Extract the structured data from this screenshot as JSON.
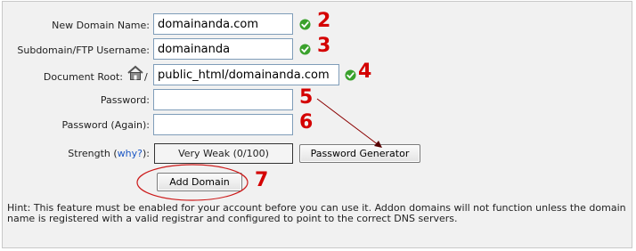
{
  "form": {
    "new_domain": {
      "label": "New Domain Name:",
      "value": "domainanda.com",
      "marker": "2"
    },
    "subdomain": {
      "label": "Subdomain/FTP Username:",
      "value": "domainanda",
      "marker": "3"
    },
    "docroot": {
      "label": "Document Root:",
      "prefix": "/",
      "value": "public_html/domainanda.com",
      "marker": "4",
      "icon": "home-icon"
    },
    "password": {
      "label": "Password:",
      "value": "",
      "marker": "5"
    },
    "password_again": {
      "label": "Password (Again):",
      "value": "",
      "marker": "6"
    },
    "strength": {
      "label": "Strength",
      "paren_open": "(",
      "why_link": "why?",
      "paren_close": "):",
      "value": "Very Weak (0/100)"
    },
    "password_generator_button": "Password Generator",
    "add_domain_button": "Add Domain",
    "add_marker": "7"
  },
  "hint": "Hint: This feature must be enabled for your account before you can use it. Addon domains will not function unless the domain name is registered with a valid registrar and configured to point to the correct DNS servers.",
  "colors": {
    "marker_red": "#d40000",
    "check_green": "#3aa12c",
    "link_blue": "#1a56c4"
  }
}
